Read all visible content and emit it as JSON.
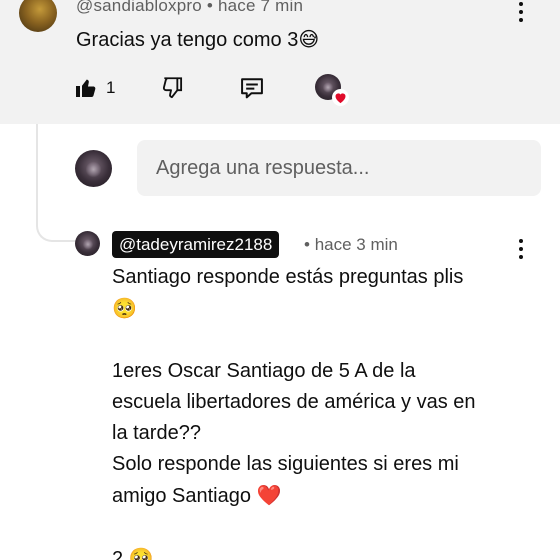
{
  "top_comment": {
    "handle": "@sandiabloxpro",
    "separator": "•",
    "time": "hace 7 min",
    "text": "Gracias ya tengo como 3",
    "emoji": "😅",
    "like_count": "1",
    "icons": {
      "like": "thumb-up-filled-icon",
      "dislike": "thumb-down-icon",
      "reply": "comment-icon",
      "creator_heart": "creator-heart-icon",
      "menu": "more-vertical-icon"
    }
  },
  "reply_box": {
    "placeholder": "Agrega una respuesta..."
  },
  "reply": {
    "handle": "@tadeyramirez2188",
    "separator": "•",
    "time": "hace 3 min",
    "lines": [
      "Santiago responde estás preguntas plis",
      "🥺",
      "",
      "1eres Oscar Santiago de 5 A de la",
      "escuela libertadores de américa y vas en",
      "la tarde??",
      "Solo responde las siguientes si eres mi",
      "amigo Santiago",
      "",
      "2",
      "🥺"
    ],
    "heart_emoji": "❤️"
  },
  "colors": {
    "background": "#ffffff",
    "highlight_background": "#f2f2f2",
    "primary_text": "#0f0f0f",
    "secondary_text": "#606060",
    "heart": "#d01a1a",
    "handle_chip": "#0f0f0f"
  }
}
